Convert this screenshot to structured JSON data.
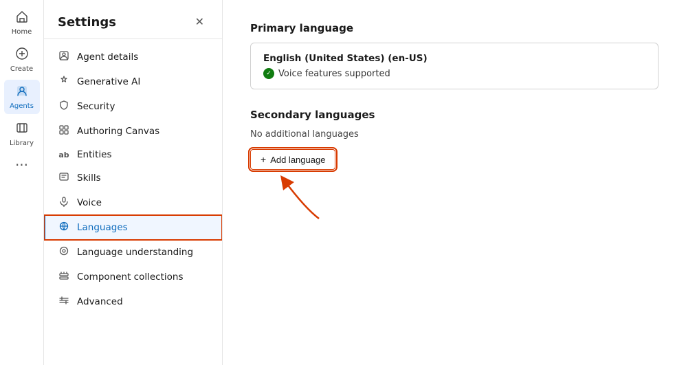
{
  "nav": {
    "items": [
      {
        "label": "Home",
        "icon": "⊞",
        "active": false
      },
      {
        "label": "Create",
        "icon": "⊕",
        "active": false
      },
      {
        "label": "Agents",
        "icon": "◉",
        "active": true
      },
      {
        "label": "Library",
        "icon": "⊟",
        "active": false
      }
    ],
    "more_icon": "···"
  },
  "sidebar": {
    "title": "Settings",
    "close_label": "✕",
    "menu_items": [
      {
        "label": "Agent details",
        "icon": "◻",
        "active": false
      },
      {
        "label": "Generative AI",
        "icon": "✧",
        "active": false
      },
      {
        "label": "Security",
        "icon": "⊙",
        "active": false
      },
      {
        "label": "Authoring Canvas",
        "icon": "⊞",
        "active": false
      },
      {
        "label": "Entities",
        "icon": "ab",
        "active": false
      },
      {
        "label": "Skills",
        "icon": "⊟",
        "active": false
      },
      {
        "label": "Voice",
        "icon": "◎",
        "active": false
      },
      {
        "label": "Languages",
        "icon": "⚙",
        "active": true
      },
      {
        "label": "Language understanding",
        "icon": "⚙",
        "active": false
      },
      {
        "label": "Component collections",
        "icon": "⊟",
        "active": false
      },
      {
        "label": "Advanced",
        "icon": "⇄",
        "active": false
      }
    ]
  },
  "main": {
    "primary_language_title": "Primary language",
    "primary_language_name": "English (United States) (en-US)",
    "voice_support_label": "Voice features supported",
    "secondary_language_title": "Secondary languages",
    "no_additional_label": "No additional languages",
    "add_language_label": "Add language",
    "add_language_icon": "+"
  }
}
